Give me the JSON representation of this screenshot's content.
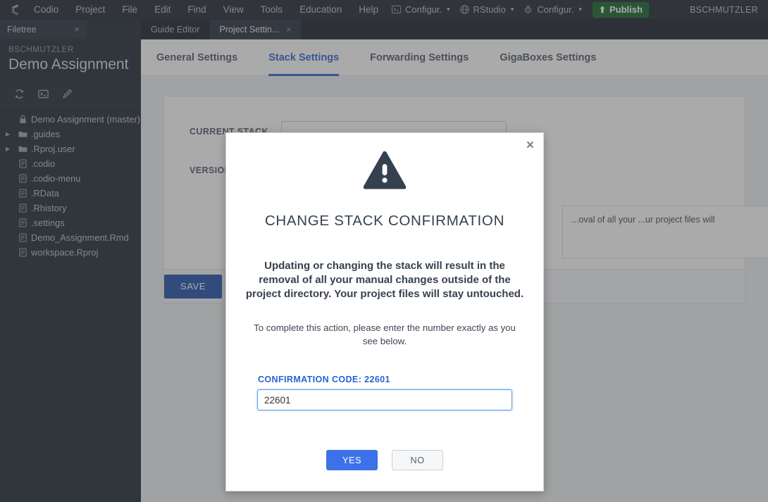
{
  "topbar": {
    "logo_name": "codio-logo",
    "menus": [
      "Codio",
      "Project",
      "File",
      "Edit",
      "Find",
      "View",
      "Tools",
      "Education",
      "Help"
    ],
    "tools": [
      {
        "icon": "terminal-icon",
        "label": "Configur.",
        "caret": "▾"
      },
      {
        "icon": "globe-icon",
        "label": "RStudio",
        "caret": "▾"
      },
      {
        "icon": "bug-icon",
        "label": "Configur.",
        "caret": "▾"
      }
    ],
    "publish_label": "Publish",
    "publish_icon": "⬆",
    "publish_color": "#0d6324",
    "user": "BSCHMUTZLER"
  },
  "sidebar": {
    "panel_tab": "Filetree",
    "panel_close": "×",
    "owner": "BSCHMUTZLER",
    "project": "Demo Assignment",
    "tools": [
      "sync-icon",
      "terminal-icon",
      "pencil-icon"
    ],
    "tree": [
      {
        "label": "Demo Assignment (master)",
        "icon": "lock-icon",
        "arrow": "",
        "indent": 0
      },
      {
        "label": ".guides",
        "icon": "folder-icon",
        "arrow": "▶",
        "indent": 0
      },
      {
        "label": ".Rproj.user",
        "icon": "folder-icon",
        "arrow": "▶",
        "indent": 0
      },
      {
        "label": ".codio",
        "icon": "file-icon",
        "arrow": "",
        "indent": 1
      },
      {
        "label": ".codio-menu",
        "icon": "file-icon",
        "arrow": "",
        "indent": 1
      },
      {
        "label": ".RData",
        "icon": "file-icon",
        "arrow": "",
        "indent": 1
      },
      {
        "label": ".Rhistory",
        "icon": "file-icon",
        "arrow": "",
        "indent": 1
      },
      {
        "label": ".settings",
        "icon": "file-icon",
        "arrow": "",
        "indent": 1
      },
      {
        "label": "Demo_Assignment.Rmd",
        "icon": "file-icon",
        "arrow": "",
        "indent": 1
      },
      {
        "label": "workspace.Rproj",
        "icon": "file-icon",
        "arrow": "",
        "indent": 1
      }
    ]
  },
  "editor_tabs": [
    {
      "label": "Guide Editor",
      "active": false,
      "closable": false
    },
    {
      "label": "Project Settin...",
      "active": true,
      "closable": true,
      "close": "×"
    }
  ],
  "settings_tabs": [
    {
      "label": "General Settings",
      "active": false
    },
    {
      "label": "Stack Settings",
      "active": true
    },
    {
      "label": "Forwarding Settings",
      "active": false
    },
    {
      "label": "GigaBoxes Settings",
      "active": false
    }
  ],
  "settings_form": {
    "rows": [
      {
        "label": "CURRENT STACK"
      },
      {
        "label": "VERSION"
      }
    ],
    "info_text": "...oval of all your ...ur project files will",
    "save_label": "SAVE",
    "save_color": "#1b4fa8"
  },
  "modal": {
    "close": "×",
    "icon": "warning-triangle-icon",
    "title": "CHANGE STACK CONFIRMATION",
    "warning": "Updating or changing the stack will result in the removal of all your manual changes outside of the project directory. Your project files will stay untouched.",
    "instruction": "To complete this action, please enter the number exactly as you see below.",
    "code_label": "CONFIRMATION CODE:",
    "code_value": "22601",
    "input_value": "22601",
    "input_placeholder": "",
    "yes_label": "YES",
    "no_label": "NO",
    "accent_color": "#2563d6",
    "yes_color": "#3b72e8"
  }
}
